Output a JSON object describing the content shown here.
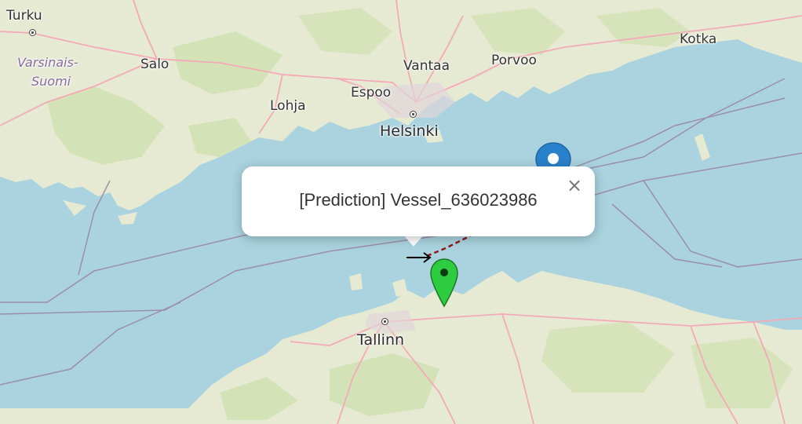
{
  "map": {
    "labels": {
      "turku": "Turku",
      "salo": "Salo",
      "region_line1": "Varsinais-",
      "region_line2": "Suomi",
      "lohja": "Lohja",
      "espoo": "Espoo",
      "vantaa": "Vantaa",
      "helsinki": "Helsinki",
      "porvoo": "Porvoo",
      "kotka": "Kotka",
      "tallinn": "Tallinn"
    },
    "colors": {
      "sea": "#aad3df",
      "land": "#e6ead3",
      "road": "#f4a9b6",
      "border": "#9a86a6",
      "route_dashed": "#8b1a1a",
      "green_marker": "#2ecc40",
      "blue_marker": "#2a81cb"
    }
  },
  "markers": {
    "blue_marker_icon": "map-pin-icon",
    "green_marker_icon": "map-pin-icon",
    "direction_arrow_icon": "arrow-right-icon"
  },
  "popup": {
    "text": "[Prediction] Vessel_636023986",
    "close_symbol": "×"
  }
}
